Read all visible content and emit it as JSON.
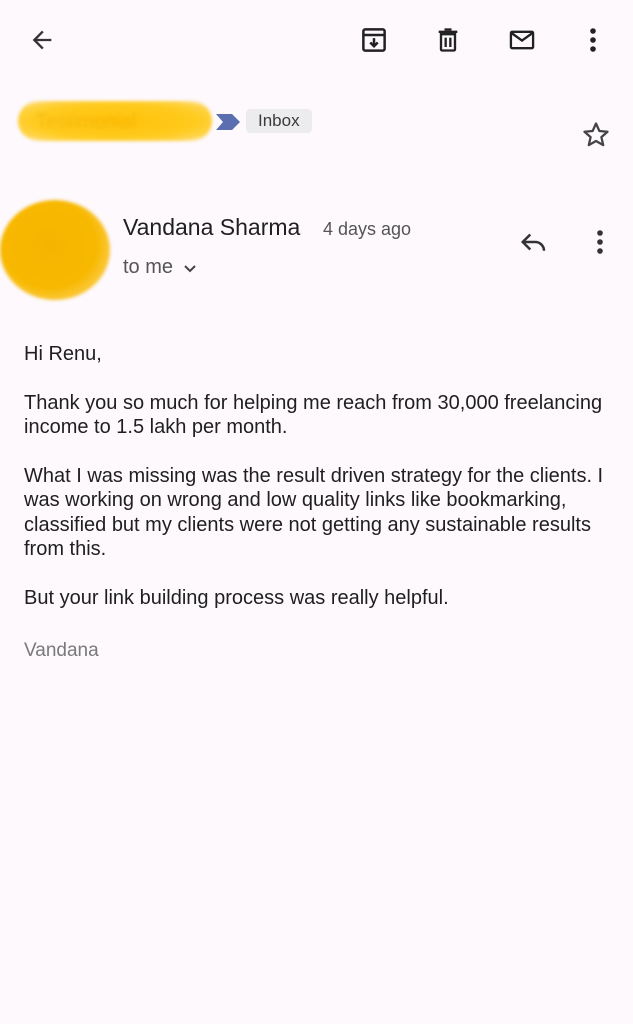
{
  "toolbar": {
    "back_icon": "arrow-back-icon",
    "archive_icon": "archive-icon",
    "delete_icon": "trash-icon",
    "mark_unread_icon": "mail-icon",
    "more_icon": "more-vert-icon"
  },
  "subject": {
    "redacted_text": "Testimonial",
    "label": "Inbox",
    "star_icon": "star-outline-icon"
  },
  "message": {
    "sender_name": "Vandana Sharma",
    "time": "4 days ago",
    "recipient": "to me",
    "reply_icon": "reply-icon",
    "more_icon": "more-vert-icon",
    "greeting": "Hi Renu,",
    "paragraph_1": "Thank you so much for helping me reach from 30,000 freelancing income to 1.5 lakh per month.",
    "paragraph_2": "What I was missing was the result driven strategy for the clients. I was working on wrong and low quality links like bookmarking, classified but my clients were not getting any sustainable results from this.",
    "paragraph_3": "But your link building process was really helpful.",
    "signature": "Vandana"
  },
  "colors": {
    "background": "#fdf9fd",
    "label_arrow": "#5b6fb0",
    "redaction": "#ffc107"
  }
}
